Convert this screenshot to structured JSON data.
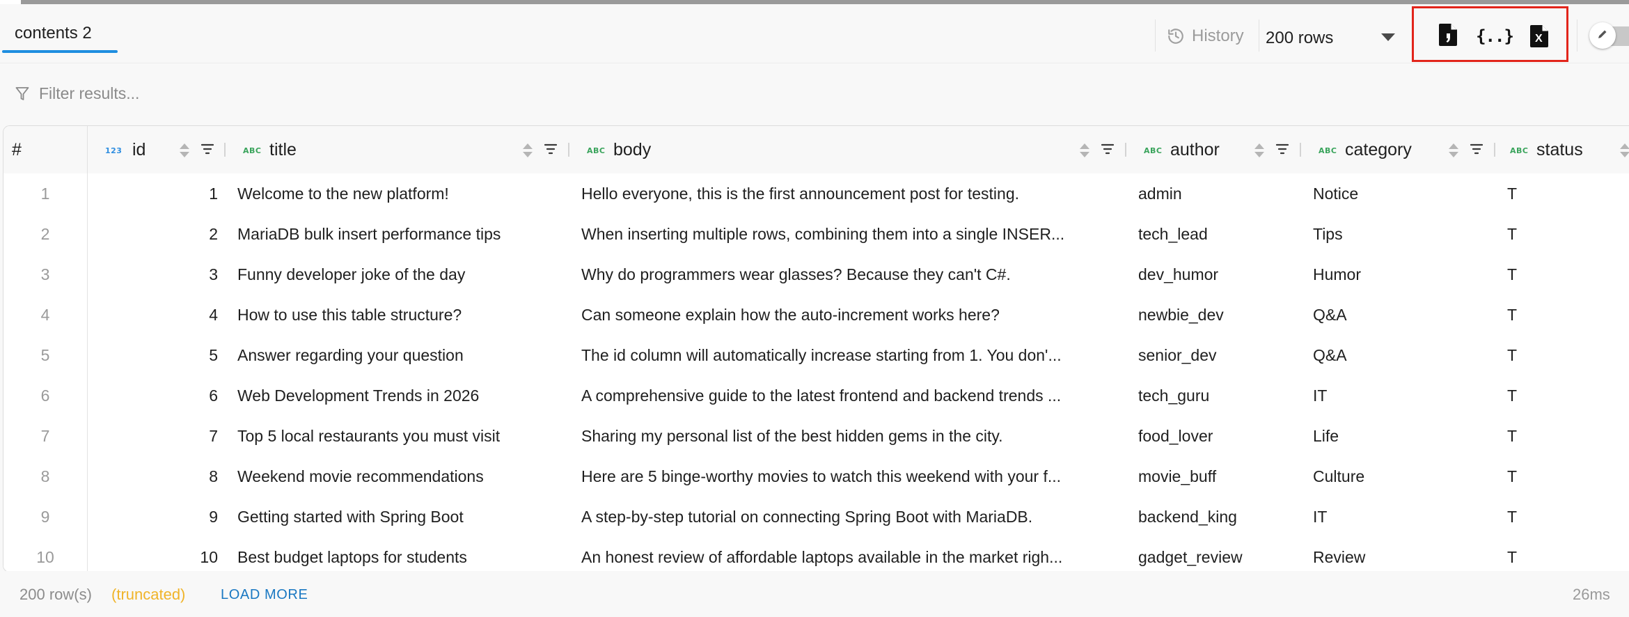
{
  "tab": {
    "label": "contents 2"
  },
  "toolbar": {
    "history_label": "History",
    "rows_selected": "200 rows",
    "export_buttons": [
      "csv-file-icon",
      "json-braces-icon",
      "excel-file-icon"
    ],
    "json_glyph": "{..}",
    "excel_glyph": "X"
  },
  "filter": {
    "placeholder": "Filter results..."
  },
  "grid": {
    "rownum_header": "#",
    "columns": [
      {
        "name": "id",
        "type": "123"
      },
      {
        "name": "title",
        "type": "ABC"
      },
      {
        "name": "body",
        "type": "ABC"
      },
      {
        "name": "author",
        "type": "ABC"
      },
      {
        "name": "category",
        "type": "ABC"
      },
      {
        "name": "status",
        "type": "ABC"
      }
    ],
    "rows": [
      {
        "n": "1",
        "id": "1",
        "title": "Welcome to the new platform!",
        "body": "Hello everyone, this is the first announcement post for testing.",
        "author": "admin",
        "category": "Notice",
        "status": "T"
      },
      {
        "n": "2",
        "id": "2",
        "title": "MariaDB bulk insert performance tips",
        "body": "When inserting multiple rows, combining them into a single INSER...",
        "author": "tech_lead",
        "category": "Tips",
        "status": "T"
      },
      {
        "n": "3",
        "id": "3",
        "title": "Funny developer joke of the day",
        "body": "Why do programmers wear glasses? Because they can't C#.",
        "author": "dev_humor",
        "category": "Humor",
        "status": "T"
      },
      {
        "n": "4",
        "id": "4",
        "title": "How to use this table structure?",
        "body": "Can someone explain how the auto-increment works here?",
        "author": "newbie_dev",
        "category": "Q&A",
        "status": "T"
      },
      {
        "n": "5",
        "id": "5",
        "title": "Answer regarding your question",
        "body": "The id column will automatically increase starting from 1. You don'...",
        "author": "senior_dev",
        "category": "Q&A",
        "status": "T"
      },
      {
        "n": "6",
        "id": "6",
        "title": "Web Development Trends in 2026",
        "body": "A comprehensive guide to the latest frontend and backend trends ...",
        "author": "tech_guru",
        "category": "IT",
        "status": "T"
      },
      {
        "n": "7",
        "id": "7",
        "title": "Top 5 local restaurants you must visit",
        "body": "Sharing my personal list of the best hidden gems in the city.",
        "author": "food_lover",
        "category": "Life",
        "status": "T"
      },
      {
        "n": "8",
        "id": "8",
        "title": "Weekend movie recommendations",
        "body": "Here are 5 binge-worthy movies to watch this weekend with your f...",
        "author": "movie_buff",
        "category": "Culture",
        "status": "T"
      },
      {
        "n": "9",
        "id": "9",
        "title": "Getting started with Spring Boot",
        "body": "A step-by-step tutorial on connecting Spring Boot with MariaDB.",
        "author": "backend_king",
        "category": "IT",
        "status": "T"
      },
      {
        "n": "10",
        "id": "10",
        "title": "Best budget laptops for students",
        "body": "An honest review of affordable laptops available in the market righ...",
        "author": "gadget_review",
        "category": "Review",
        "status": "T"
      }
    ]
  },
  "footer": {
    "row_count": "200 row(s)",
    "truncated": "(truncated)",
    "load_more": "LOAD MORE",
    "elapsed": "26ms"
  }
}
